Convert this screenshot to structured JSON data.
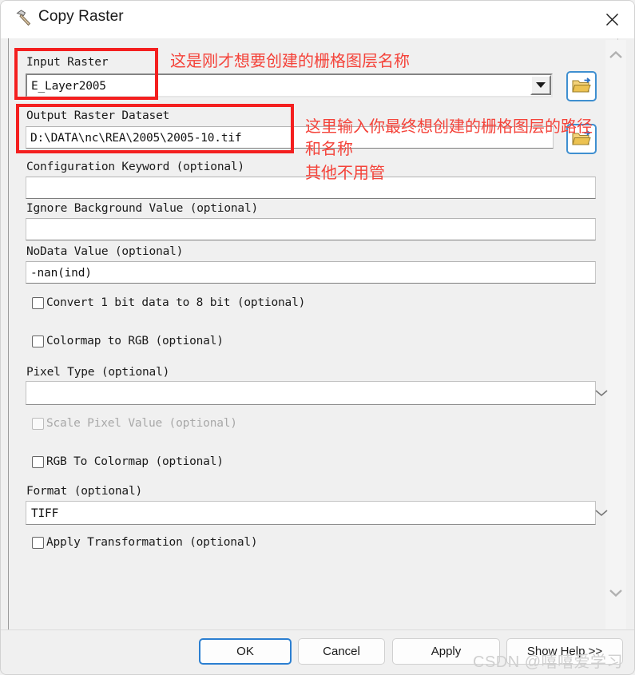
{
  "window": {
    "title": "Copy Raster",
    "icon": "hammer-tool-icon",
    "close_label": "✕"
  },
  "fields": {
    "input_raster": {
      "label": "Input Raster",
      "value": "E_Layer2005",
      "browse_icon": "folder-open-icon"
    },
    "output_raster_dataset": {
      "label": "Output Raster Dataset",
      "value": "D:\\DATA\\nc\\REA\\2005\\2005-10.tif",
      "browse_icon": "folder-open-icon"
    },
    "configuration_keyword": {
      "label": "Configuration Keyword (optional)",
      "value": ""
    },
    "ignore_background_value": {
      "label": "Ignore Background Value (optional)",
      "value": ""
    },
    "nodata_value": {
      "label": "NoData Value (optional)",
      "value": "-nan(ind)"
    },
    "convert_1bit_to_8bit": {
      "label": "Convert 1 bit data to 8 bit (optional)",
      "checked": false,
      "disabled": false
    },
    "colormap_to_rgb": {
      "label": "Colormap to RGB (optional)",
      "checked": false,
      "disabled": false
    },
    "pixel_type": {
      "label": "Pixel Type (optional)",
      "value": ""
    },
    "scale_pixel_value": {
      "label": "Scale Pixel Value (optional)",
      "checked": false,
      "disabled": true
    },
    "rgb_to_colormap": {
      "label": "RGB To Colormap (optional)",
      "checked": false,
      "disabled": false
    },
    "format": {
      "label": "Format (optional)",
      "value": "TIFF"
    },
    "apply_transformation": {
      "label": "Apply Transformation (optional)",
      "checked": false,
      "disabled": false
    }
  },
  "annotations": {
    "color": "#f4433a",
    "input_raster_note": "这是刚才想要创建的栅格图层名称",
    "output_note_line1": "这里输入你最终想创建的栅格图层的路径",
    "output_note_line2": "和名称",
    "output_note_line3": "其他不用管"
  },
  "buttons": {
    "ok": "OK",
    "cancel": "Cancel",
    "apply": "Apply",
    "show_help": "Show Help >>"
  },
  "scrollbar": {
    "up_icon": "chevron-up-icon",
    "down_icon": "chevron-down-icon"
  },
  "watermark": "CSDN @嘻嘻爱学习"
}
